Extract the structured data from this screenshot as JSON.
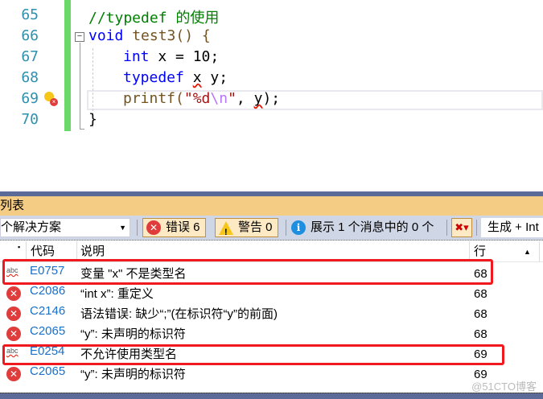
{
  "editor": {
    "lines": [
      {
        "num": "65",
        "text": "//typedef 的使用"
      },
      {
        "num": "66",
        "kw": "void",
        "fn": " test3() {"
      },
      {
        "num": "67",
        "kw": "int",
        "rest": " x = 10;"
      },
      {
        "num": "68",
        "kw": "typedef",
        "sq": "x",
        "rest": " y;"
      },
      {
        "num": "69",
        "fn": "printf(",
        "str1": "\"%d",
        "esc": "\\n",
        "str2": "\"",
        "mid": ", ",
        "sq": "y",
        "rest": ");"
      },
      {
        "num": "70",
        "text": "}"
      }
    ]
  },
  "error_list": {
    "title": "列表",
    "scope": "个解决方案",
    "errors_label": "错误 6",
    "warnings_label": "警告 0",
    "messages_label": "展示 1 个消息中的 0 个",
    "build_filter": "生成 + Int",
    "columns": {
      "code": "代码",
      "desc": "说明",
      "line": "行"
    },
    "rows": [
      {
        "icon": "abc",
        "code": "E0757",
        "desc": "变量 \"x\" 不是类型名",
        "line": "68"
      },
      {
        "icon": "error",
        "code": "C2086",
        "desc": "“int x”: 重定义",
        "line": "68"
      },
      {
        "icon": "error",
        "code": "C2146",
        "desc": "语法错误: 缺少“;”(在标识符“y”的前面)",
        "line": "68"
      },
      {
        "icon": "error",
        "code": "C2065",
        "desc": "“y”: 未声明的标识符",
        "line": "68"
      },
      {
        "icon": "abc",
        "code": "E0254",
        "desc": "不允许使用类型名",
        "line": "69"
      },
      {
        "icon": "error",
        "code": "C2065",
        "desc": "“y”: 未声明的标识符",
        "line": "69"
      }
    ]
  },
  "watermark": "@51CTO博客"
}
